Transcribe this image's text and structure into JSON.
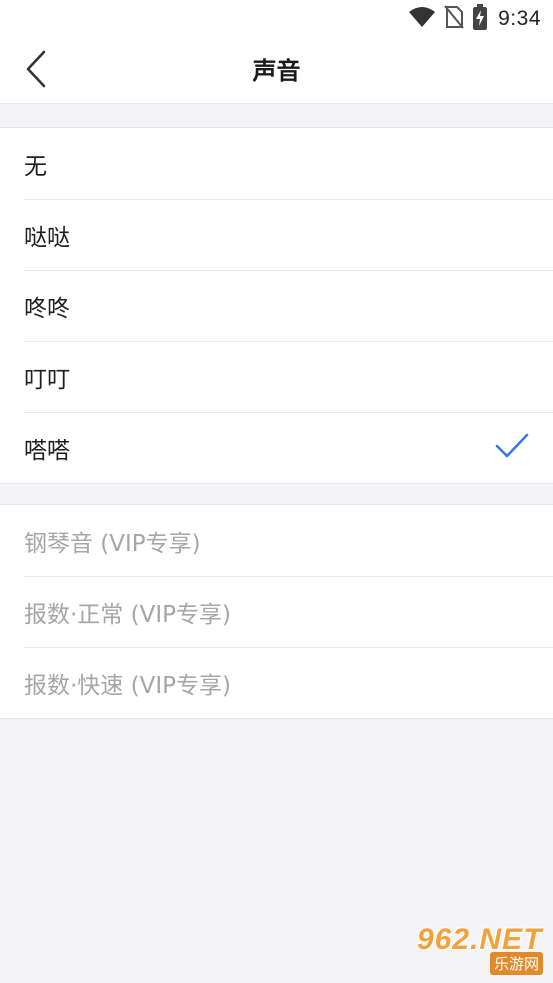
{
  "status_bar": {
    "time": "9:34",
    "icons": [
      "wifi-icon",
      "no-sim-icon",
      "battery-charging-icon"
    ]
  },
  "nav": {
    "title": "声音",
    "back_icon": "chevron-left-icon"
  },
  "sound_options": [
    {
      "label": "无",
      "selected": false
    },
    {
      "label": "哒哒",
      "selected": false
    },
    {
      "label": "咚咚",
      "selected": false
    },
    {
      "label": "叮叮",
      "selected": false
    },
    {
      "label": "嗒嗒",
      "selected": true
    }
  ],
  "vip_options": [
    {
      "label": "钢琴音 (VIP专享)"
    },
    {
      "label": "报数·正常 (VIP专享)"
    },
    {
      "label": "报数·快速 (VIP专享)"
    }
  ],
  "watermark": {
    "line1": "962.NET",
    "line2": "乐游网"
  },
  "colors": {
    "accent": "#3a7bd5",
    "background": "#f4f4f6",
    "disabled_text": "#a6a6aa"
  }
}
